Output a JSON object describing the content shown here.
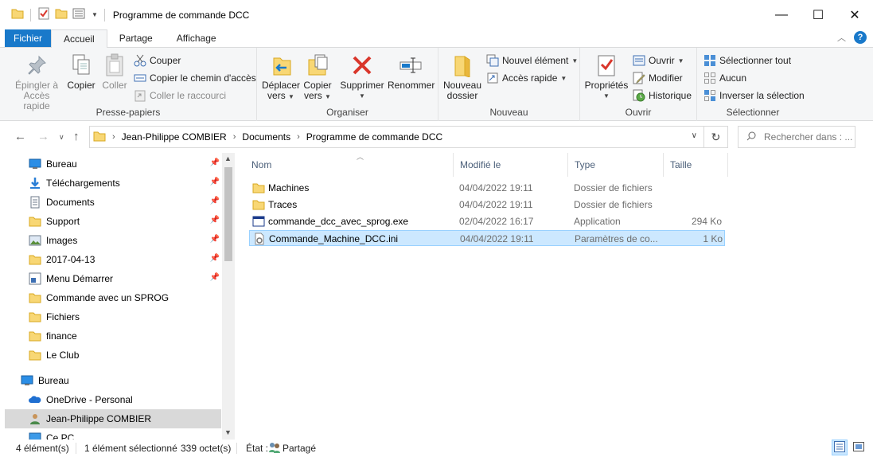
{
  "window": {
    "title": "Programme de commande DCC",
    "controls": {
      "minimize": "—",
      "maximize": "☐",
      "close": "✕"
    }
  },
  "tabs": {
    "file": "Fichier",
    "home": "Accueil",
    "share": "Partage",
    "view": "Affichage"
  },
  "ribbon": {
    "clipboard": {
      "label": "Presse-papiers",
      "pin": "Épingler à Accès rapide",
      "pin_l1": "Épingler à",
      "pin_l2": "Accès rapide",
      "copy": "Copier",
      "paste": "Coller",
      "cut": "Couper",
      "copy_path": "Copier le chemin d'accès",
      "paste_shortcut": "Coller le raccourci"
    },
    "organize": {
      "label": "Organiser",
      "move_l1": "Déplacer",
      "move_l2": "vers",
      "copy_l1": "Copier",
      "copy_l2": "vers",
      "delete": "Supprimer",
      "rename": "Renommer"
    },
    "new": {
      "label": "Nouveau",
      "folder_l1": "Nouveau",
      "folder_l2": "dossier",
      "new_item": "Nouvel élément",
      "easy_access": "Accès rapide"
    },
    "open": {
      "label": "Ouvrir",
      "properties": "Propriétés",
      "open": "Ouvrir",
      "edit": "Modifier",
      "history": "Historique"
    },
    "select": {
      "label": "Sélectionner",
      "select_all": "Sélectionner tout",
      "select_none": "Aucun",
      "invert": "Inverser la sélection"
    }
  },
  "address": {
    "crumbs": [
      "Jean-Philippe COMBIER",
      "Documents",
      "Programme de commande DCC"
    ],
    "search_placeholder": "Rechercher dans : ..."
  },
  "nav": {
    "quick_access": [
      {
        "label": "Bureau",
        "icon": "desktop-icon",
        "pinned": true
      },
      {
        "label": "Téléchargements",
        "icon": "download-icon",
        "pinned": true
      },
      {
        "label": "Documents",
        "icon": "documents-icon",
        "pinned": true
      },
      {
        "label": "Support",
        "icon": "folder-icon",
        "pinned": true
      },
      {
        "label": "Images",
        "icon": "pictures-icon",
        "pinned": true
      },
      {
        "label": "2017-04-13",
        "icon": "folder-icon",
        "pinned": true
      },
      {
        "label": "Menu Démarrer",
        "icon": "start-menu-icon",
        "pinned": true
      },
      {
        "label": "Commande avec un SPROG",
        "icon": "folder-icon",
        "pinned": false
      },
      {
        "label": "Fichiers",
        "icon": "folder-icon",
        "pinned": false
      },
      {
        "label": "finance",
        "icon": "folder-icon",
        "pinned": false
      },
      {
        "label": "Le Club",
        "icon": "folder-icon",
        "pinned": false
      }
    ],
    "tree": [
      {
        "label": "Bureau",
        "icon": "desktop-icon"
      },
      {
        "label": "OneDrive - Personal",
        "icon": "cloud-icon"
      },
      {
        "label": "Jean-Philippe COMBIER",
        "icon": "user-icon"
      },
      {
        "label": "Ce PC",
        "icon": "computer-icon"
      }
    ]
  },
  "columns": {
    "name": "Nom",
    "modified": "Modifié le",
    "type": "Type",
    "size": "Taille"
  },
  "files": [
    {
      "name": "Machines",
      "modified": "04/04/2022 19:11",
      "type": "Dossier de fichiers",
      "size": "",
      "icon": "folder-icon"
    },
    {
      "name": "Traces",
      "modified": "04/04/2022 19:11",
      "type": "Dossier de fichiers",
      "size": "",
      "icon": "folder-icon"
    },
    {
      "name": "commande_dcc_avec_sprog.exe",
      "modified": "02/04/2022 16:17",
      "type": "Application",
      "size": "294 Ko",
      "icon": "application-icon"
    },
    {
      "name": "Commande_Machine_DCC.ini",
      "modified": "04/04/2022 19:11",
      "type": "Paramètres de co...",
      "size": "1 Ko",
      "icon": "settings-file-icon"
    }
  ],
  "status": {
    "count": "4 élément(s)",
    "selection": "1 élément sélectionné",
    "selection_size": "339 octet(s)",
    "state_label": "État :",
    "state_value": "Partagé"
  },
  "colors": {
    "accent": "#1979ca",
    "selection": "#cce8ff",
    "folder": "#f8d775"
  }
}
